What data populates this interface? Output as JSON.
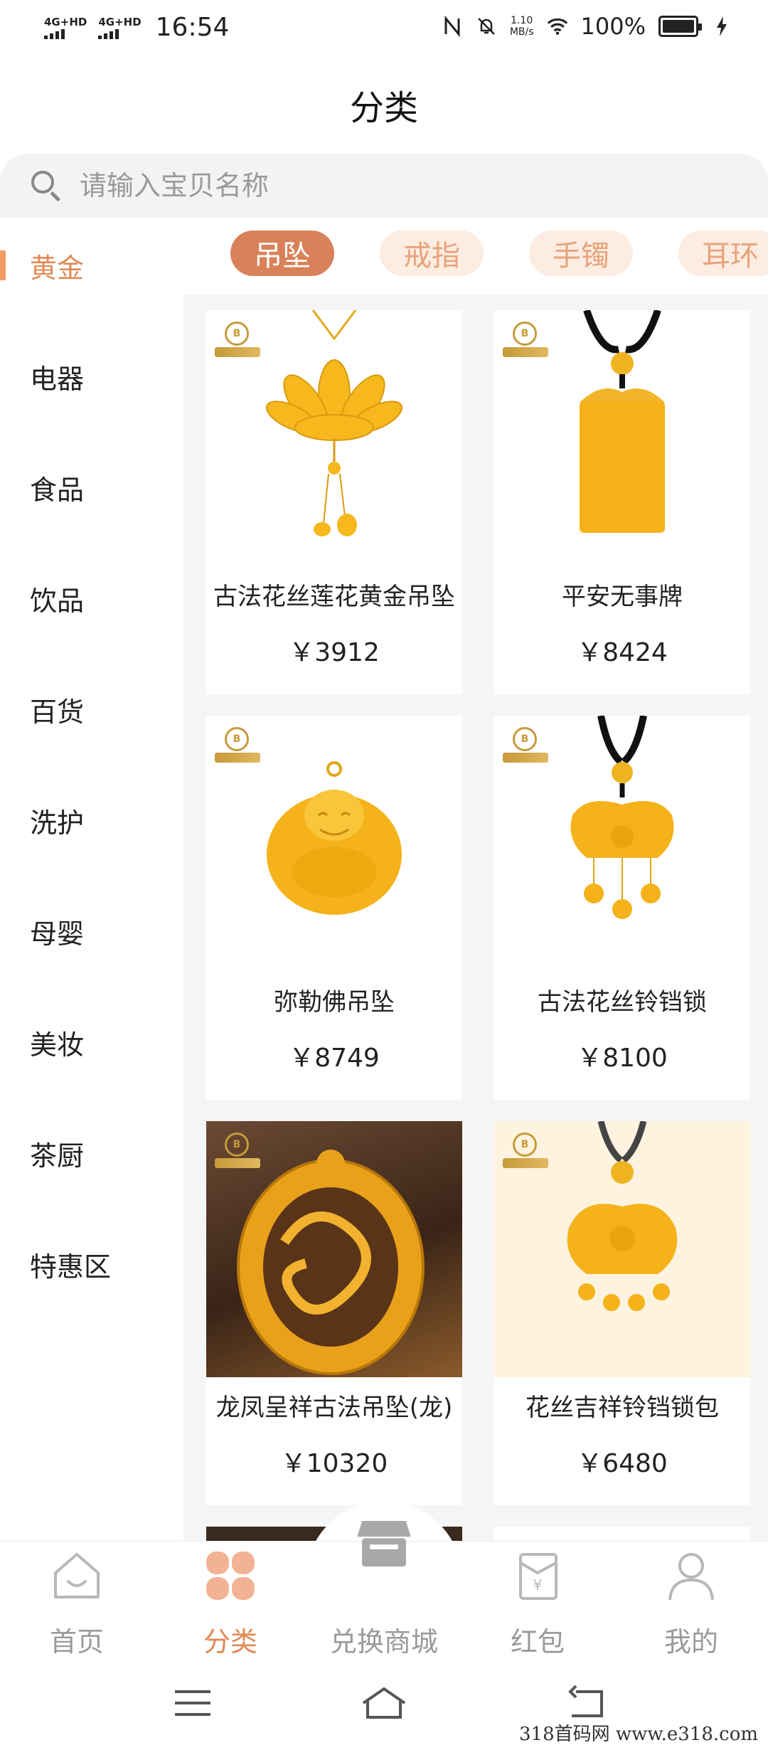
{
  "status_bar": {
    "network_1": "4G+HD",
    "network_2": "4G+HD",
    "time": "16:54",
    "speed_value": "1.10",
    "speed_unit": "MB/s",
    "battery": "100%"
  },
  "header": {
    "title": "分类"
  },
  "search": {
    "placeholder": "请输入宝贝名称"
  },
  "sidebar": {
    "items": [
      {
        "label": "黄金",
        "active": true
      },
      {
        "label": "电器"
      },
      {
        "label": "食品"
      },
      {
        "label": "饮品"
      },
      {
        "label": "百货"
      },
      {
        "label": "洗护"
      },
      {
        "label": "母婴"
      },
      {
        "label": "美妆"
      },
      {
        "label": "茶厨"
      },
      {
        "label": "特惠区"
      }
    ]
  },
  "subtabs": [
    {
      "label": "吊坠",
      "active": true
    },
    {
      "label": "戒指"
    },
    {
      "label": "手镯"
    },
    {
      "label": "耳环"
    }
  ],
  "products": [
    {
      "name": "古法花丝莲花黄金吊坠",
      "price": "￥3912"
    },
    {
      "name": "平安无事牌",
      "price": "￥8424"
    },
    {
      "name": "弥勒佛吊坠",
      "price": "￥8749"
    },
    {
      "name": "古法花丝铃铛锁",
      "price": "￥8100"
    },
    {
      "name": "龙凤呈祥古法吊坠(龙)",
      "price": "￥10320"
    },
    {
      "name": "花丝吉祥铃铛锁包",
      "price": "￥6480"
    }
  ],
  "tabbar": {
    "items": [
      {
        "label": "首页",
        "icon": "home-icon"
      },
      {
        "label": "分类",
        "icon": "category-icon",
        "active": true
      },
      {
        "label": "兑换商城",
        "icon": "store-icon"
      },
      {
        "label": "红包",
        "icon": "red-packet-icon"
      },
      {
        "label": "我的",
        "icon": "profile-icon"
      }
    ]
  },
  "watermark": "318首码网  www.e318.com",
  "colors": {
    "accent": "#e08a55",
    "tab_active_bg": "#d9825a",
    "tab_inactive_bg": "#fcece1",
    "gold": "#f5b21a"
  }
}
